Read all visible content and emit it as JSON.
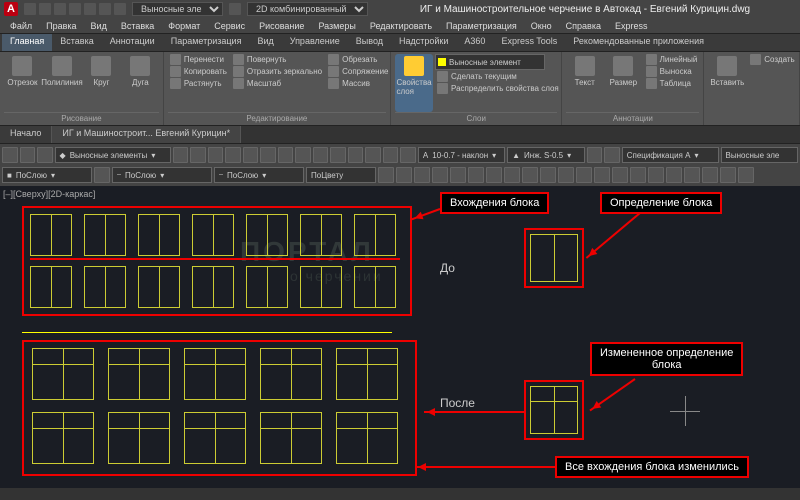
{
  "title": "ИГ и Машиностроительное черчение в Автокад - Евгений Курицин.dwg",
  "app_badge": "A",
  "titlebar_selects": [
    "Выносные эле",
    "2D комбинированный"
  ],
  "menus": [
    "Файл",
    "Правка",
    "Вид",
    "Вставка",
    "Формат",
    "Сервис",
    "Рисование",
    "Размеры",
    "Редактировать",
    "Параметризация",
    "Окно",
    "Справка",
    "Express"
  ],
  "ribbon_tabs": [
    "Главная",
    "Вставка",
    "Аннотации",
    "Параметризация",
    "Вид",
    "Управление",
    "Вывод",
    "Надстройки",
    "A360",
    "Express Tools",
    "Рекомендованные приложения"
  ],
  "active_ribbon_tab": 0,
  "panels": {
    "draw": {
      "title": "Рисование",
      "btns": [
        "Отрезок",
        "Полилиния",
        "Круг",
        "Дуга"
      ]
    },
    "modify": {
      "title": "Редактирование",
      "rows": [
        "Перенести",
        "Копировать",
        "Растянуть",
        "Повернуть",
        "Отразить зеркально",
        "Масштаб",
        "Обрезать",
        "Сопряжение",
        "Массив"
      ]
    },
    "layers": {
      "title": "Слои",
      "main": "Свойства\nслоя",
      "combo": "Выносные элемент",
      "rows": [
        "Сделать текущим",
        "Распределить свойства слоя"
      ]
    },
    "annot": {
      "title": "Аннотации",
      "btns": [
        "Текст",
        "Размер"
      ],
      "rows": [
        "Линейный",
        "Выноска",
        "Таблица"
      ]
    },
    "block": {
      "title": "",
      "btns": [
        "Вставить"
      ],
      "rows": [
        "Создать"
      ]
    }
  },
  "doctabs": [
    "Начало",
    "ИГ и Машиностроит... Евгений Курицин*"
  ],
  "active_doctab": 1,
  "layer_combos": [
    "Выносные элементы",
    "ПоСлою",
    "ПоСлою",
    "ПоСлою",
    "ПоЦвету"
  ],
  "style_combos": [
    "10-0.7 - наклон",
    "Инж. S-0.5",
    "Спецификация А",
    "Выносные эле"
  ],
  "viewcube_label": "[–][Сверху][2D-каркас]",
  "labels": {
    "block_refs": "Вхождения блока",
    "block_def": "Определение блока",
    "before": "До",
    "after": "После",
    "changed_def": "Измененное определение\nблока",
    "all_changed": "Все вхождения блока изменились"
  },
  "watermark": {
    "l1": "ПОРТАЛ",
    "l2": "о черчении"
  }
}
